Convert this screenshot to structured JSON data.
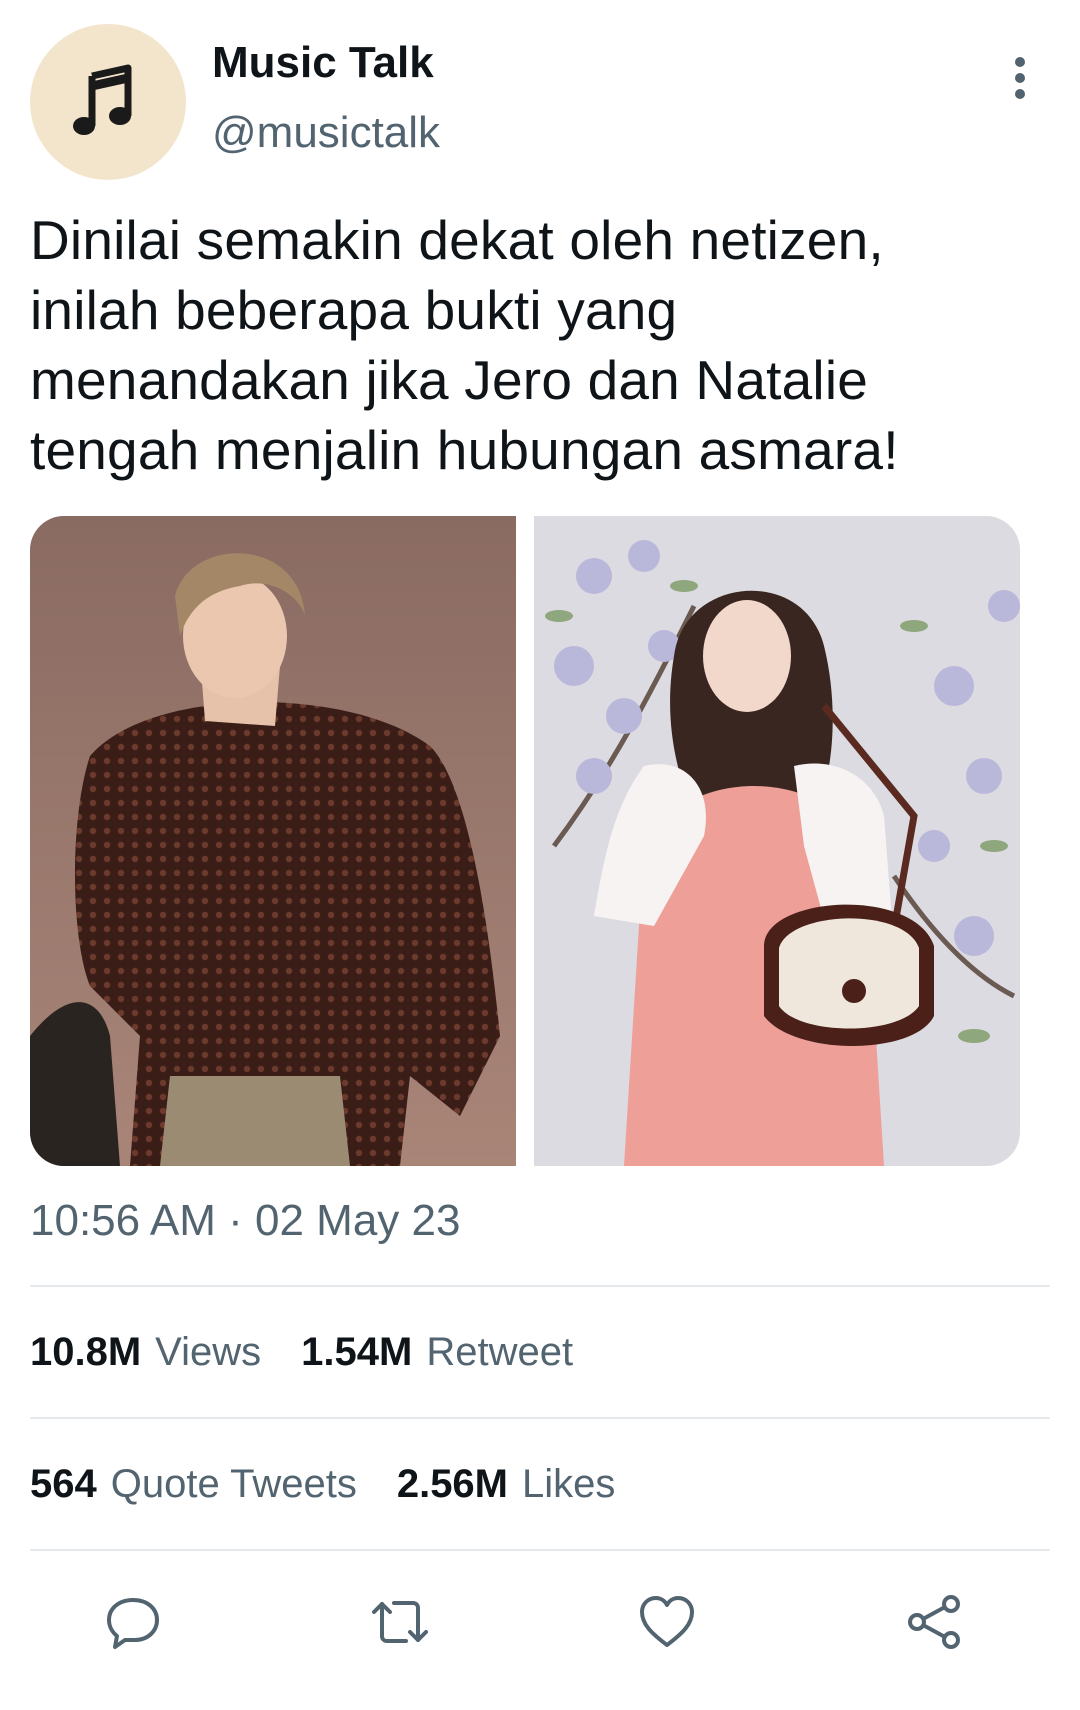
{
  "tweet": {
    "author": {
      "display_name": "Music Talk",
      "handle": "@musictalk",
      "avatar_icon": "music-note-icon",
      "avatar_bg": "#f3e5cc"
    },
    "text_lines": [
      "Dinilai semakin dekat oleh netizen,",
      "inilah beberapa bukti yang",
      "menandakan jika Jero dan Natalie",
      "tengah menjalin hubungan asmara!"
    ],
    "timestamp": "10:56 AM · 02 May 23",
    "stats": {
      "views": {
        "value": "10.8M",
        "label": "Views"
      },
      "retweets": {
        "value": "1.54M",
        "label": "Retweet"
      },
      "quotes": {
        "value": "564",
        "label": "Quote Tweets"
      },
      "likes": {
        "value": "2.56M",
        "label": "Likes"
      }
    },
    "actions": [
      "reply-icon",
      "retweet-icon",
      "like-icon",
      "share-icon"
    ]
  },
  "colors": {
    "text_primary": "#0f1419",
    "text_secondary": "#536471",
    "icon": "#536471",
    "divider": "#e6e9ec"
  }
}
